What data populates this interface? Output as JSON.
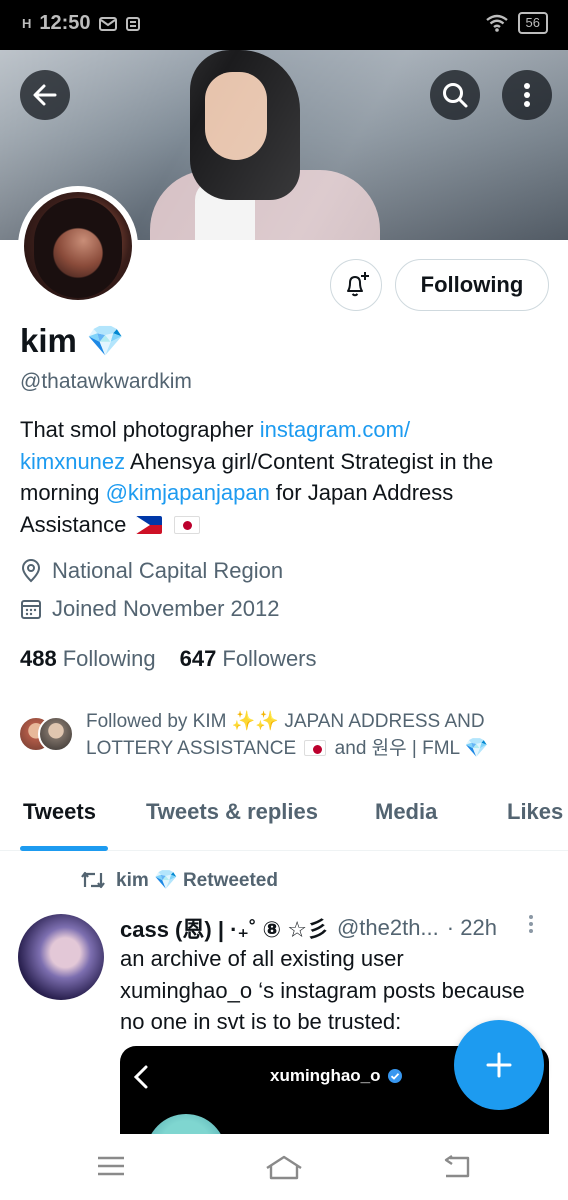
{
  "status_bar": {
    "network": "H",
    "signal": "ıl",
    "time": "12:50",
    "battery": "56"
  },
  "colors": {
    "accent": "#1d9bf0",
    "text_primary": "#0f1419",
    "text_secondary": "#536471"
  },
  "header": {
    "back_icon": "arrow-left-icon",
    "search_icon": "search-icon",
    "more_icon": "more-vertical-icon"
  },
  "profile": {
    "name": "kim",
    "name_badge": "💎",
    "handle": "@thatawkwardkim",
    "follow_button": "Following",
    "bio": {
      "part1": "That smol photographer ",
      "link1": "instagram.com/",
      "link2": "kimxnunez",
      "part2": "   Ahensya girl/Content Strategist in the morning ",
      "mention": "@kimjapanjapan",
      "part3": " for Japan Address Assistance "
    },
    "location": "National Capital Region",
    "joined": "Joined November 2012",
    "following_count": "488",
    "following_label": "Following",
    "followers_count": "647",
    "followers_label": "Followers",
    "followed_by": {
      "line1": "Followed by KIM ✨✨ JAPAN ADDRESS AND",
      "line2_a": "LOTTERY ASSISTANCE ",
      "line2_b": " and 원우 | FML 💎"
    }
  },
  "tabs": [
    {
      "label": "Tweets"
    },
    {
      "label": "Tweets & replies"
    },
    {
      "label": "Media"
    },
    {
      "label": "Likes"
    }
  ],
  "tweet": {
    "retweeted_by": "kim 💎 Retweeted",
    "author_name": "cass (恩) | ·₊˚ ⑧ ☆彡",
    "author_handle": "@the2th...",
    "time": "· 22h",
    "text": "an archive of all existing user xuminghao_o ‘s instagram posts because no one in svt is to be trusted:",
    "media_title": "xuminghao_o"
  },
  "nav_bar": {
    "menu_icon": "menu-icon",
    "home_icon": "home-icon",
    "back_icon": "back-icon"
  }
}
